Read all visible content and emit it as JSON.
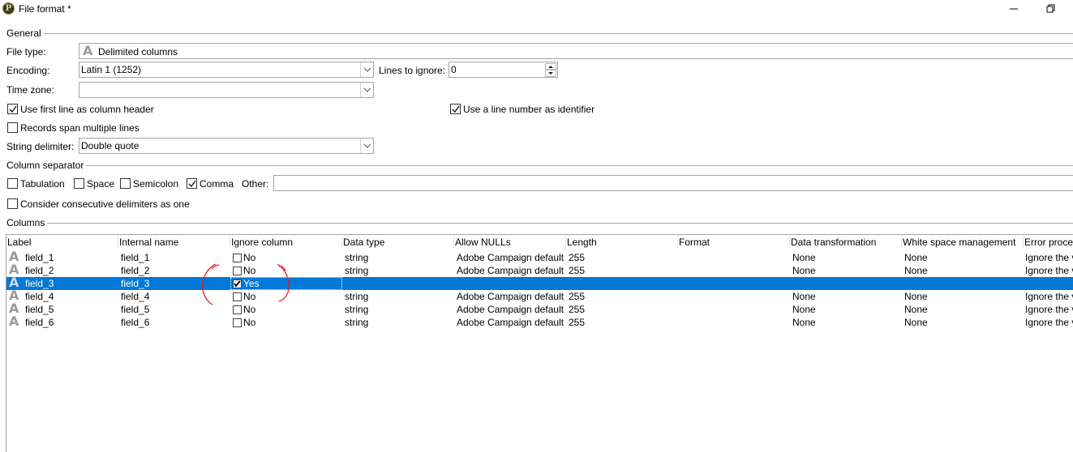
{
  "window": {
    "title": "File format *",
    "app_icon_letter": "P"
  },
  "general": {
    "group_label": "General",
    "file_type_label": "File type:",
    "file_type_value": "Delimited columns",
    "encoding_label": "Encoding:",
    "encoding_value": "Latin 1 (1252)",
    "lines_to_ignore_label": "Lines to ignore:",
    "lines_to_ignore_value": "0",
    "time_zone_label": "Time zone:",
    "time_zone_value": "",
    "use_first_line_label": "Use first line as column header",
    "use_first_line_checked": true,
    "use_line_number_label": "Use a line number as identifier",
    "use_line_number_checked": true,
    "records_span_label": "Records span multiple lines",
    "records_span_checked": false,
    "string_delimiter_label": "String delimiter:",
    "string_delimiter_value": "Double quote"
  },
  "column_separator": {
    "group_label": "Column separator",
    "tabulation_label": "Tabulation",
    "space_label": "Space",
    "semicolon_label": "Semicolon",
    "comma_label": "Comma",
    "other_label": "Other:",
    "other_value": "",
    "consecutive_label": "Consider consecutive delimiters as one",
    "checked": {
      "tabulation": false,
      "space": false,
      "semicolon": false,
      "comma": true,
      "consecutive": false
    }
  },
  "columns": {
    "group_label": "Columns",
    "headers": [
      "Label",
      "Internal name",
      "Ignore column",
      "Data type",
      "Allow NULLs",
      "Length",
      "Format",
      "Data transformation",
      "White space management",
      "Error proces"
    ],
    "rows": [
      {
        "label": "field_1",
        "internal": "field_1",
        "ignore": "No",
        "ignore_checked": false,
        "type": "string",
        "nulls": "Adobe Campaign default",
        "length": "255",
        "format": "",
        "transform": "None",
        "whitespace": "None",
        "error": "Ignore the v"
      },
      {
        "label": "field_2",
        "internal": "field_2",
        "ignore": "No",
        "ignore_checked": false,
        "type": "string",
        "nulls": "Adobe Campaign default",
        "length": "255",
        "format": "",
        "transform": "None",
        "whitespace": "None",
        "error": "Ignore the v"
      },
      {
        "label": "field_3",
        "internal": "field_3",
        "ignore": "Yes",
        "ignore_checked": true,
        "type": "",
        "nulls": "",
        "length": "",
        "format": "",
        "transform": "",
        "whitespace": "",
        "error": ""
      },
      {
        "label": "field_4",
        "internal": "field_4",
        "ignore": "No",
        "ignore_checked": false,
        "type": "string",
        "nulls": "Adobe Campaign default",
        "length": "255",
        "format": "",
        "transform": "None",
        "whitespace": "None",
        "error": "Ignore the v"
      },
      {
        "label": "field_5",
        "internal": "field_5",
        "ignore": "No",
        "ignore_checked": false,
        "type": "string",
        "nulls": "Adobe Campaign default",
        "length": "255",
        "format": "",
        "transform": "None",
        "whitespace": "None",
        "error": "Ignore the v"
      },
      {
        "label": "field_6",
        "internal": "field_6",
        "ignore": "No",
        "ignore_checked": false,
        "type": "string",
        "nulls": "Adobe Campaign default",
        "length": "255",
        "format": "",
        "transform": "None",
        "whitespace": "None",
        "error": "Ignore the v"
      }
    ],
    "selected_row": 2
  },
  "colors": {
    "selection": "#0078d7",
    "annotation": "#e0221f"
  }
}
